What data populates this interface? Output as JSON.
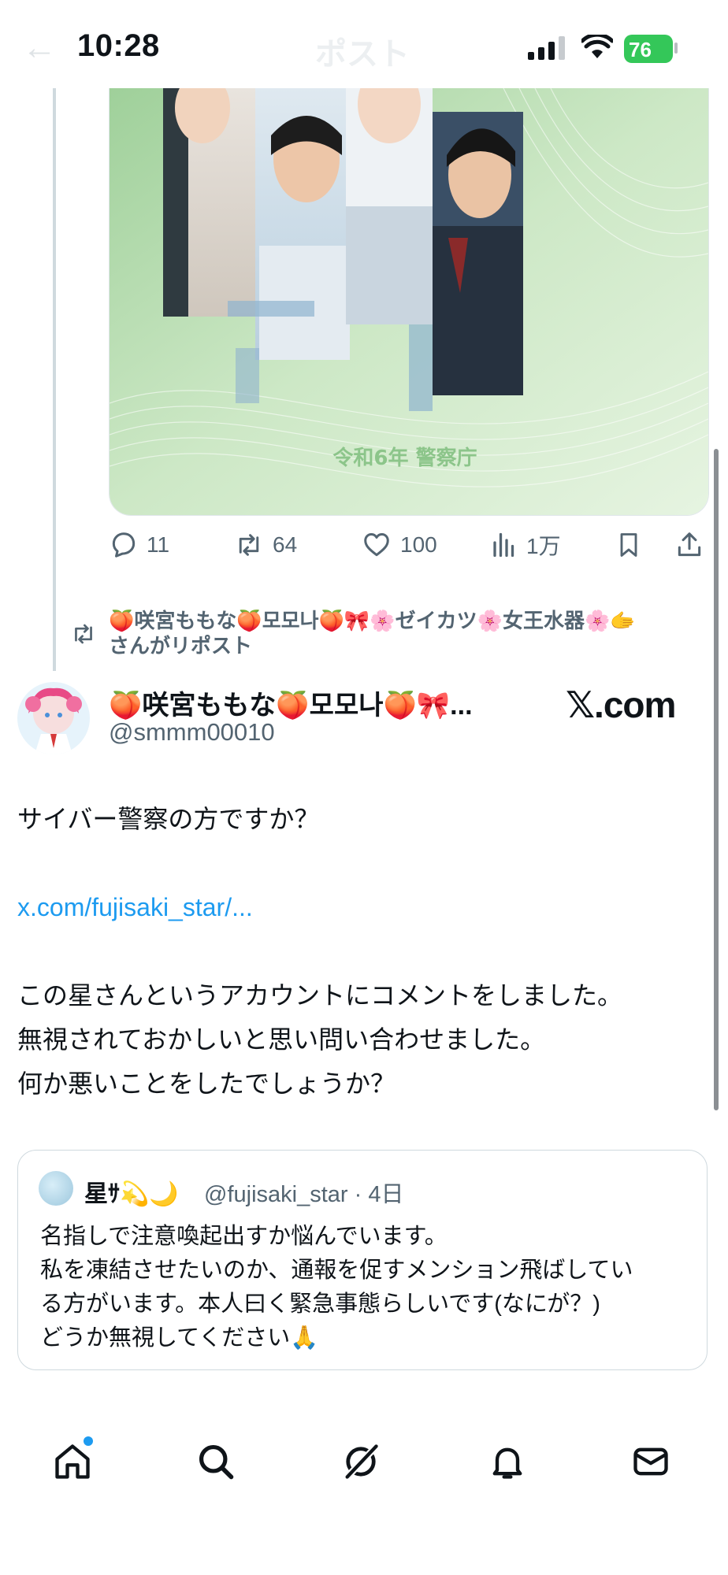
{
  "status_bar": {
    "time": "10:28",
    "battery": "76",
    "back_label": "←",
    "title": "ポスト"
  },
  "media": {
    "caption": "令和6年 警察庁"
  },
  "actions": {
    "replies": "11",
    "reposts": "64",
    "likes": "100",
    "views": "1万"
  },
  "repost_banner": {
    "line1": "🍑咲宮ももな🍑모모나🍑🎀🌸ゼイカツ🌸女王水器🌸🫱",
    "line2": "さんがリポスト"
  },
  "post": {
    "author_name": "🍑咲宮ももな🍑모모나🍑🎀...",
    "author_handle": "@smmm00010",
    "source_badge": "𝕏.com",
    "line1": "サイバー警察の方ですか？",
    "link": "x.com/fujisaki_star/...",
    "line2": "この星さんというアカウントにコメントをしました。",
    "line3": "無視されておかしいと思い問い合わせました。",
    "line4": "何か悪いことをしたでしょうか？"
  },
  "quote": {
    "name": "星ｻ💫🌙",
    "handle_date": "@fujisaki_star · 4日",
    "line1": "名指しで注意喚起出すか悩んでいます。",
    "line2": "私を凍結させたいのか、通報を促すメンション飛ばしてい",
    "line3": "る方がいます。本人曰く緊急事態らしいです(なにが？)",
    "line4": "どうか無視してください🙏"
  },
  "tabbar": {
    "items": [
      "home-icon",
      "search-icon",
      "grok-icon",
      "bell-icon",
      "mail-icon"
    ],
    "accent": "#1d9bf0"
  },
  "colors": {
    "link": "#1d9bf0",
    "secondary_text": "#536471",
    "battery": "#34c759"
  }
}
